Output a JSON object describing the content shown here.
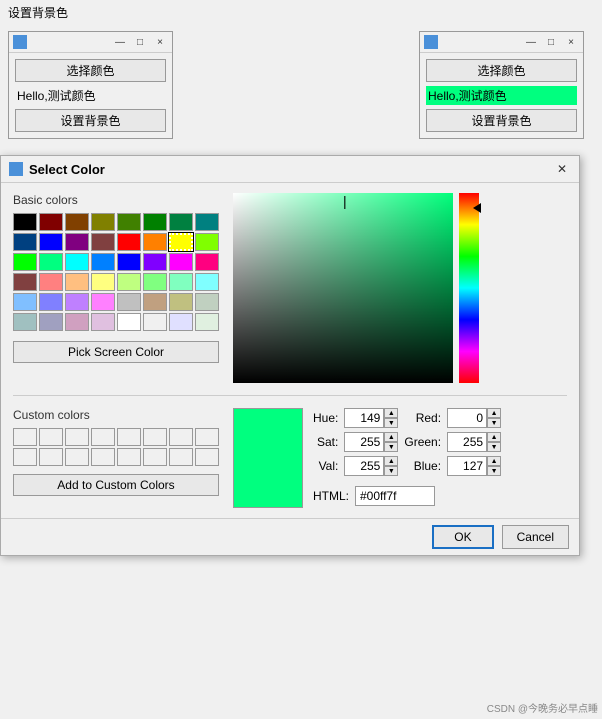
{
  "topbar": {
    "label": "设置背景色"
  },
  "miniWindows": [
    {
      "id": "left",
      "titleIcon": true,
      "buttons": [
        "—",
        "□",
        "×"
      ],
      "chooseLabel": "选择颜色",
      "helloText": "Hello,测试颜色",
      "setBgLabel": "设置背景色",
      "highlighted": false
    },
    {
      "id": "right",
      "titleIcon": true,
      "buttons": [
        "—",
        "□",
        "×"
      ],
      "chooseLabel": "选择颜色",
      "helloText": "Hello,测试颜色",
      "setBgLabel": "设置背景色",
      "highlighted": true
    }
  ],
  "dialog": {
    "title": "Select Color",
    "closeBtn": "✕",
    "basicColorsLabel": "Basic colors",
    "basicColors": [
      "#000000",
      "#800000",
      "#804000",
      "#808000",
      "#408000",
      "#008000",
      "#008040",
      "#008080",
      "#004080",
      "#0000ff",
      "#800080",
      "#804040",
      "#ff0000",
      "#ff8000",
      "#ffff00",
      "#80ff00",
      "#00ff00",
      "#00ff80",
      "#00ffff",
      "#0080ff",
      "#0000ff",
      "#8000ff",
      "#ff00ff",
      "#ff0080",
      "#804040",
      "#ff8080",
      "#ffbf80",
      "#ffff80",
      "#bfff80",
      "#80ff80",
      "#80ffbf",
      "#80ffff",
      "#80bfff",
      "#8080ff",
      "#bf80ff",
      "#ff80ff",
      "#c0c0c0",
      "#c0a080",
      "#c0c080",
      "#c0d0c0",
      "#a0c0c0",
      "#a0a0c0",
      "#d0a0c0",
      "#e0c0e0",
      "#ffffff",
      "#f0f0f0",
      "#e0e0ff",
      "#e0f0e0"
    ],
    "selectedColorIndex": 14,
    "pickScreenLabel": "Pick Screen Color",
    "customColorsLabel": "Custom colors",
    "customColors": [
      "",
      "",
      "",
      "",
      "",
      "",
      "",
      "",
      "",
      "",
      "",
      "",
      "",
      "",
      "",
      ""
    ],
    "addCustomLabel": "Add to Custom Colors",
    "colorPreview": "#00ff7f",
    "hue": {
      "label": "Hue:",
      "value": "149"
    },
    "sat": {
      "label": "Sat:",
      "value": "255"
    },
    "val": {
      "label": "Val:",
      "value": "255"
    },
    "red": {
      "label": "Red:",
      "value": "0"
    },
    "green": {
      "label": "Green:",
      "value": "255"
    },
    "blue": {
      "label": "Blue:",
      "value": "127"
    },
    "html": {
      "label": "HTML:",
      "value": "#00ff7f"
    },
    "okLabel": "OK",
    "cancelLabel": "Cancel"
  }
}
